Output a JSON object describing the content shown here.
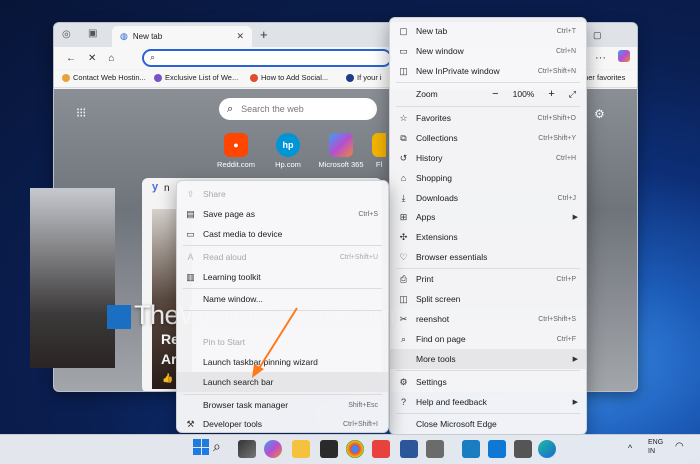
{
  "browser": {
    "tab_title": "New tab",
    "favorites": [
      "Contact Web Hostin...",
      "Exclusive List of We...",
      "How to Add Social...",
      "If your i",
      "ther favorites"
    ]
  },
  "newtab": {
    "search_placeholder": "Search the web",
    "tiles": [
      "Reddit.com",
      "Hp.com",
      "Microsoft 365",
      "Fl"
    ],
    "card_text": [
      "Re",
      "Ar"
    ]
  },
  "watermark": "TheWindowsClub.com",
  "menu": {
    "items": [
      {
        "label": "New tab",
        "shortcut": "Ctrl+T",
        "icon": "new-tab-icon"
      },
      {
        "label": "New window",
        "shortcut": "Ctrl+N",
        "icon": "window-icon"
      },
      {
        "label": "New InPrivate window",
        "shortcut": "Ctrl+Shift+N",
        "icon": "inprivate-icon"
      },
      {
        "label": "Zoom",
        "zoom": "100%",
        "icon": "zoom-icon"
      },
      {
        "label": "Favorites",
        "shortcut": "Ctrl+Shift+O",
        "icon": "star-icon"
      },
      {
        "label": "Collections",
        "shortcut": "Ctrl+Shift+Y",
        "icon": "collections-icon"
      },
      {
        "label": "History",
        "shortcut": "Ctrl+H",
        "icon": "history-icon"
      },
      {
        "label": "Shopping",
        "shortcut": "",
        "icon": "shopping-icon"
      },
      {
        "label": "Downloads",
        "shortcut": "Ctrl+J",
        "icon": "download-icon"
      },
      {
        "label": "Apps",
        "shortcut": "",
        "icon": "apps-icon"
      },
      {
        "label": "Extensions",
        "shortcut": "",
        "icon": "puzzle-icon"
      },
      {
        "label": "Browser essentials",
        "shortcut": "",
        "icon": "heart-icon"
      },
      {
        "label": "Print",
        "shortcut": "Ctrl+P",
        "icon": "print-icon"
      },
      {
        "label": "Split screen",
        "shortcut": "",
        "icon": "split-screen-icon"
      },
      {
        "label": "reenshot",
        "shortcut": "Ctrl+Shift+S",
        "icon": "screenshot-icon"
      },
      {
        "label": "Find on page",
        "shortcut": "Ctrl+F",
        "icon": "find-icon"
      },
      {
        "label": "More tools",
        "shortcut": "",
        "icon": "more-tools-icon"
      },
      {
        "label": "Settings",
        "shortcut": "",
        "icon": "gear-icon"
      },
      {
        "label": "Help and feedback",
        "shortcut": "",
        "icon": "help-icon"
      },
      {
        "label": "Close Microsoft Edge",
        "shortcut": "",
        "icon": ""
      }
    ]
  },
  "submenu": {
    "items": [
      {
        "label": "Share",
        "shortcut": "",
        "icon": "share-icon"
      },
      {
        "label": "Save page as",
        "shortcut": "Ctrl+S",
        "icon": "save-icon"
      },
      {
        "label": "Cast media to device",
        "shortcut": "",
        "icon": "cast-icon"
      },
      {
        "label": "Read aloud",
        "shortcut": "Ctrl+Shift+U",
        "icon": "read-aloud-icon"
      },
      {
        "label": "Learning toolkit",
        "shortcut": "",
        "icon": "learning-icon"
      },
      {
        "label": "Name window...",
        "shortcut": "",
        "icon": ""
      },
      {
        "label": "Pin to Start",
        "shortcut": "",
        "icon": ""
      },
      {
        "label": "Launch taskbar pinning wizard",
        "shortcut": "",
        "icon": ""
      },
      {
        "label": "Launch search bar",
        "shortcut": "",
        "icon": ""
      },
      {
        "label": "Browser task manager",
        "shortcut": "Shift+Esc",
        "icon": ""
      },
      {
        "label": "Developer tools",
        "shortcut": "Ctrl+Shift+I",
        "icon": "devtools-icon"
      }
    ]
  },
  "tray": {
    "lang1": "ENG",
    "lang2": "IN"
  }
}
